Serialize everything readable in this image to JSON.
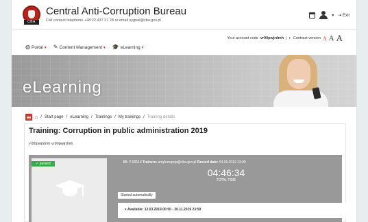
{
  "header": {
    "logo_text": "CBA",
    "title": "Central Anti-Corruption Bureau",
    "subtitle": "Call contact telephone +48 22 437 27 28 or email sygnal@cba.gov.pl",
    "logout_label": "Exit",
    "icons": [
      "calendar-icon",
      "user-icon",
      "logout-icon"
    ]
  },
  "account": {
    "code_label": "Your account code",
    "code": "vr90pwjrdmh",
    "contrast_label": "Contrast version",
    "font_small": "A",
    "font_medium": "A",
    "font_large": "A"
  },
  "nav": {
    "items": [
      {
        "label": "Portal",
        "icon": "globe-icon"
      },
      {
        "label": "Content Management",
        "icon": "edit-icon"
      },
      {
        "label": "eLearning",
        "icon": "graduation-cap-icon"
      }
    ]
  },
  "banner": {
    "title": "eLearning"
  },
  "breadcrumb": {
    "items": [
      "Start page",
      "eLearning",
      "Trainings",
      "My trainings"
    ],
    "current": "Training details"
  },
  "training": {
    "title": "Training: Corruption in public administration 2019",
    "user_codes": "vr90pwjrdmh vr90pwjrdmh",
    "status": "passed",
    "id_label": "ID:",
    "id_value": "P 00513",
    "trainers_label": "Trainers:",
    "trainers_value": "antykorupcja@cba.gov.pl",
    "record_label": "Record date:",
    "record_value": "04.06.2019 13:39",
    "time": "04:46:34",
    "time_label": "TOTAL TIME",
    "started_label": "Started automatically",
    "available_label": "Available:",
    "available_value": "12.03.2019 00:00 - 20.11.2019 23:59"
  },
  "colors": {
    "accent": "#c0392b",
    "success": "#3aa94a",
    "panel": "#999999"
  }
}
